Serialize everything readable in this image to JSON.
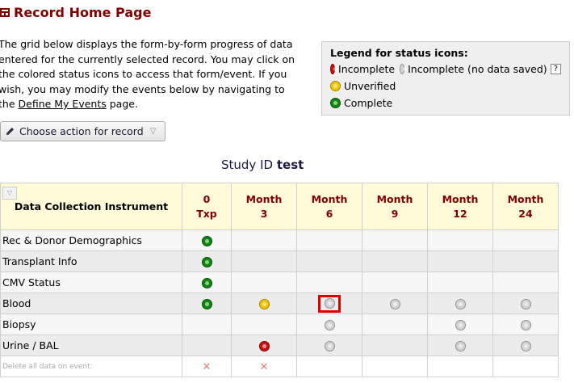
{
  "page": {
    "title": "Record Home Page"
  },
  "intro": {
    "text": "The grid below displays the form-by-form progress of data entered for the currently selected record. You may click on the colored status icons to access that form/event. If you wish, you may modify the events below by navigating to the ",
    "link": "Define My Events",
    "suffix": " page."
  },
  "legend": {
    "heading": "Legend for status icons:",
    "incomplete": "Incomplete",
    "incomplete_nodata": "Incomplete (no data saved)",
    "help": "?",
    "unverified": "Unverified",
    "complete": "Complete"
  },
  "action": {
    "label": "Choose action for record"
  },
  "study": {
    "label": "Study ID",
    "value": "test"
  },
  "grid": {
    "first_header": "Data Collection Instrument",
    "events": [
      {
        "l1": "0",
        "l2": "Txp"
      },
      {
        "l1": "Month",
        "l2": "3"
      },
      {
        "l1": "Month",
        "l2": "6"
      },
      {
        "l1": "Month",
        "l2": "9"
      },
      {
        "l1": "Month",
        "l2": "12"
      },
      {
        "l1": "Month",
        "l2": "24"
      }
    ],
    "rows": [
      {
        "name": "Rec & Donor Demographics",
        "cells": [
          "green",
          "",
          "",
          "",
          "",
          ""
        ]
      },
      {
        "name": "Transplant Info",
        "cells": [
          "green",
          "",
          "",
          "",
          "",
          ""
        ]
      },
      {
        "name": "CMV Status",
        "cells": [
          "green",
          "",
          "",
          "",
          "",
          ""
        ]
      },
      {
        "name": "Blood",
        "cells": [
          "green",
          "yellow",
          "gray-hl",
          "gray",
          "gray",
          "gray"
        ]
      },
      {
        "name": "Biopsy",
        "cells": [
          "",
          "",
          "gray",
          "",
          "gray",
          "gray"
        ]
      },
      {
        "name": "Urine / BAL",
        "cells": [
          "",
          "red",
          "gray",
          "",
          "gray",
          "gray"
        ]
      }
    ],
    "delete_label": "Delete all data on event:",
    "delete_cells": [
      "x",
      "x",
      "",
      "",
      "",
      ""
    ],
    "delete_mark": "✕"
  },
  "colors": {
    "title": "#800000",
    "header_bg": "#fffad8",
    "highlight": "#e00000"
  }
}
